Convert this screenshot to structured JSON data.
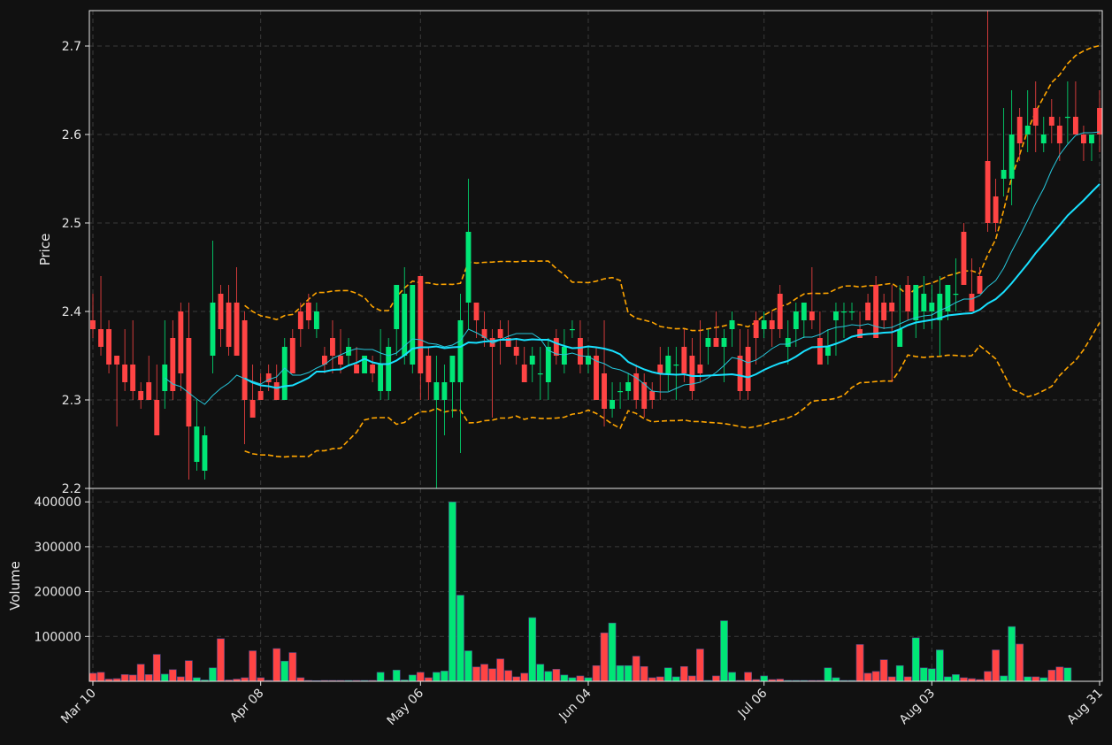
{
  "chart_data": {
    "type": "candlestick",
    "title": "",
    "ylabel_price": "Price",
    "ylabel_volume": "Volume",
    "price_ylim": [
      2.2,
      2.74
    ],
    "price_yticks": [
      "2.2",
      "2.3",
      "2.4",
      "2.5",
      "2.6",
      "2.7"
    ],
    "volume_ylim": [
      0,
      430000
    ],
    "volume_yticks": [
      "100000",
      "200000",
      "300000",
      "400000"
    ],
    "x_tick_labels": [
      "Mar 10",
      "Apr 08",
      "May 06",
      "Jun 04",
      "Jul 06",
      "Aug 03",
      "Aug 31"
    ],
    "x_tick_index": [
      0,
      21,
      41,
      62,
      84,
      105,
      126
    ],
    "grid": true,
    "up_color": "#00e676",
    "down_color": "#ff4444",
    "ma_colors": [
      "#26c6da",
      "#18e0ff"
    ],
    "bollinger_color": "#ffa500",
    "background_color": "#111111",
    "moving_averages": [
      "MA short",
      "MA long"
    ],
    "bollinger_bands": "dashed upper/lower bands",
    "ohlc": [
      [
        2.39,
        2.42,
        2.37,
        2.38
      ],
      [
        2.38,
        2.44,
        2.35,
        2.36
      ],
      [
        2.38,
        2.39,
        2.33,
        2.34
      ],
      [
        2.35,
        2.35,
        2.27,
        2.34
      ],
      [
        2.34,
        2.38,
        2.31,
        2.32
      ],
      [
        2.34,
        2.39,
        2.3,
        2.31
      ],
      [
        2.31,
        2.32,
        2.29,
        2.3
      ],
      [
        2.32,
        2.35,
        2.3,
        2.3
      ],
      [
        2.3,
        2.34,
        2.26,
        2.26
      ],
      [
        2.31,
        2.39,
        2.29,
        2.34
      ],
      [
        2.37,
        2.39,
        2.3,
        2.31
      ],
      [
        2.4,
        2.41,
        2.31,
        2.33
      ],
      [
        2.37,
        2.41,
        2.21,
        2.27
      ],
      [
        2.23,
        2.3,
        2.22,
        2.27
      ],
      [
        2.22,
        2.27,
        2.21,
        2.26
      ],
      [
        2.35,
        2.48,
        2.33,
        2.41
      ],
      [
        2.42,
        2.43,
        2.36,
        2.38
      ],
      [
        2.41,
        2.43,
        2.35,
        2.36
      ],
      [
        2.41,
        2.45,
        2.35,
        2.35
      ],
      [
        2.39,
        2.4,
        2.25,
        2.3
      ],
      [
        2.3,
        2.34,
        2.28,
        2.28
      ],
      [
        2.31,
        2.33,
        2.3,
        2.3
      ],
      [
        2.33,
        2.34,
        2.31,
        2.32
      ],
      [
        2.32,
        2.34,
        2.3,
        2.3
      ],
      [
        2.3,
        2.37,
        2.3,
        2.36
      ],
      [
        2.37,
        2.38,
        2.33,
        2.33
      ],
      [
        2.4,
        2.41,
        2.36,
        2.38
      ],
      [
        2.41,
        2.42,
        2.38,
        2.39
      ],
      [
        2.38,
        2.41,
        2.37,
        2.4
      ],
      [
        2.35,
        2.36,
        2.33,
        2.34
      ],
      [
        2.37,
        2.39,
        2.33,
        2.35
      ],
      [
        2.35,
        2.38,
        2.33,
        2.34
      ],
      [
        2.35,
        2.37,
        2.34,
        2.36
      ],
      [
        2.34,
        2.36,
        2.33,
        2.33
      ],
      [
        2.33,
        2.35,
        2.33,
        2.35
      ],
      [
        2.34,
        2.35,
        2.32,
        2.33
      ],
      [
        2.31,
        2.38,
        2.3,
        2.34
      ],
      [
        2.31,
        2.37,
        2.3,
        2.36
      ],
      [
        2.38,
        2.43,
        2.35,
        2.43
      ],
      [
        2.35,
        2.45,
        2.34,
        2.42
      ],
      [
        2.34,
        2.43,
        2.33,
        2.43
      ],
      [
        2.44,
        2.44,
        2.3,
        2.33
      ],
      [
        2.35,
        2.36,
        2.3,
        2.32
      ],
      [
        2.3,
        2.35,
        2.2,
        2.32
      ],
      [
        2.3,
        2.34,
        2.26,
        2.32
      ],
      [
        2.32,
        2.35,
        2.28,
        2.35
      ],
      [
        2.32,
        2.42,
        2.24,
        2.39
      ],
      [
        2.41,
        2.55,
        2.38,
        2.49
      ],
      [
        2.41,
        2.41,
        2.37,
        2.39
      ],
      [
        2.38,
        2.4,
        2.36,
        2.37
      ],
      [
        2.37,
        2.38,
        2.28,
        2.36
      ],
      [
        2.38,
        2.39,
        2.34,
        2.37
      ],
      [
        2.37,
        2.39,
        2.36,
        2.36
      ],
      [
        2.36,
        2.37,
        2.34,
        2.35
      ],
      [
        2.34,
        2.36,
        2.32,
        2.32
      ],
      [
        2.34,
        2.36,
        2.32,
        2.35
      ],
      [
        2.33,
        2.36,
        2.3,
        2.33
      ],
      [
        2.32,
        2.37,
        2.3,
        2.36
      ],
      [
        2.37,
        2.38,
        2.34,
        2.35
      ],
      [
        2.34,
        2.38,
        2.33,
        2.36
      ],
      [
        2.38,
        2.39,
        2.37,
        2.38
      ],
      [
        2.37,
        2.39,
        2.33,
        2.34
      ],
      [
        2.34,
        2.36,
        2.33,
        2.35
      ],
      [
        2.35,
        2.36,
        2.3,
        2.3
      ],
      [
        2.33,
        2.39,
        2.27,
        2.29
      ],
      [
        2.29,
        2.32,
        2.28,
        2.3
      ],
      [
        2.31,
        2.32,
        2.29,
        2.31
      ],
      [
        2.31,
        2.33,
        2.3,
        2.32
      ],
      [
        2.33,
        2.34,
        2.29,
        2.3
      ],
      [
        2.32,
        2.33,
        2.28,
        2.29
      ],
      [
        2.31,
        2.32,
        2.29,
        2.3
      ],
      [
        2.34,
        2.36,
        2.3,
        2.33
      ],
      [
        2.33,
        2.36,
        2.31,
        2.35
      ],
      [
        2.34,
        2.36,
        2.3,
        2.34
      ],
      [
        2.36,
        2.38,
        2.32,
        2.33
      ],
      [
        2.35,
        2.37,
        2.3,
        2.31
      ],
      [
        2.34,
        2.39,
        2.32,
        2.33
      ],
      [
        2.36,
        2.38,
        2.34,
        2.37
      ],
      [
        2.37,
        2.4,
        2.36,
        2.36
      ],
      [
        2.36,
        2.38,
        2.32,
        2.37
      ],
      [
        2.38,
        2.4,
        2.36,
        2.39
      ],
      [
        2.35,
        2.38,
        2.3,
        2.31
      ],
      [
        2.36,
        2.38,
        2.3,
        2.31
      ],
      [
        2.39,
        2.4,
        2.34,
        2.37
      ],
      [
        2.38,
        2.4,
        2.37,
        2.39
      ],
      [
        2.39,
        2.4,
        2.36,
        2.38
      ],
      [
        2.42,
        2.43,
        2.37,
        2.38
      ],
      [
        2.36,
        2.39,
        2.34,
        2.37
      ],
      [
        2.38,
        2.41,
        2.36,
        2.4
      ],
      [
        2.39,
        2.41,
        2.37,
        2.41
      ],
      [
        2.4,
        2.45,
        2.38,
        2.39
      ],
      [
        2.37,
        2.4,
        2.34,
        2.34
      ],
      [
        2.35,
        2.38,
        2.34,
        2.36
      ],
      [
        2.39,
        2.41,
        2.35,
        2.4
      ],
      [
        2.4,
        2.41,
        2.37,
        2.4
      ],
      [
        2.4,
        2.41,
        2.39,
        2.4
      ],
      [
        2.38,
        2.4,
        2.37,
        2.37
      ],
      [
        2.41,
        2.42,
        2.39,
        2.39
      ],
      [
        2.43,
        2.44,
        2.37,
        2.37
      ],
      [
        2.41,
        2.42,
        2.38,
        2.39
      ],
      [
        2.41,
        2.43,
        2.32,
        2.4
      ],
      [
        2.36,
        2.43,
        2.36,
        2.38
      ],
      [
        2.43,
        2.44,
        2.39,
        2.4
      ],
      [
        2.39,
        2.43,
        2.37,
        2.43
      ],
      [
        2.4,
        2.44,
        2.38,
        2.42
      ],
      [
        2.4,
        2.43,
        2.38,
        2.41
      ],
      [
        2.39,
        2.44,
        2.35,
        2.42
      ],
      [
        2.4,
        2.43,
        2.39,
        2.43
      ],
      [
        2.42,
        2.46,
        2.4,
        2.42
      ],
      [
        2.49,
        2.5,
        2.43,
        2.43
      ],
      [
        2.42,
        2.46,
        2.4,
        2.4
      ],
      [
        2.44,
        2.45,
        2.42,
        2.42
      ],
      [
        2.57,
        2.74,
        2.49,
        2.5
      ],
      [
        2.53,
        2.55,
        2.49,
        2.5
      ],
      [
        2.55,
        2.63,
        2.53,
        2.56
      ],
      [
        2.55,
        2.65,
        2.52,
        2.6
      ],
      [
        2.62,
        2.63,
        2.57,
        2.59
      ],
      [
        2.6,
        2.65,
        2.58,
        2.61
      ],
      [
        2.63,
        2.66,
        2.58,
        2.61
      ],
      [
        2.59,
        2.62,
        2.58,
        2.6
      ],
      [
        2.62,
        2.64,
        2.59,
        2.61
      ],
      [
        2.61,
        2.62,
        2.57,
        2.59
      ],
      [
        2.62,
        2.66,
        2.59,
        2.62
      ],
      [
        2.62,
        2.66,
        2.6,
        2.6
      ],
      [
        2.6,
        2.61,
        2.57,
        2.59
      ],
      [
        2.59,
        2.6,
        2.57,
        2.6
      ],
      [
        2.63,
        2.65,
        2.58,
        2.6
      ]
    ],
    "volume": [
      18000,
      20000,
      5000,
      6000,
      15000,
      14000,
      38000,
      15000,
      60000,
      16000,
      26000,
      10000,
      46000,
      8000,
      3000,
      30000,
      95000,
      3000,
      5000,
      8000,
      68000,
      8000,
      2000,
      73000,
      45000,
      64000,
      8000,
      2000,
      1500,
      2000,
      2000,
      2000,
      2000,
      2000,
      2000,
      2000,
      20000,
      2000,
      25000,
      3000,
      14000,
      20000,
      8000,
      20000,
      23000,
      400000,
      192000,
      68000,
      32000,
      38000,
      28000,
      50000,
      24000,
      10000,
      18000,
      142000,
      38000,
      22000,
      27000,
      14000,
      8000,
      12000,
      8000,
      35000,
      108000,
      130000,
      35000,
      35000,
      56000,
      33000,
      8000,
      10000,
      30000,
      10000,
      33000,
      12000,
      72000,
      2000,
      12000,
      135000,
      20000,
      2000,
      20000,
      4000,
      12000,
      4000,
      5000,
      2000,
      2000,
      2000,
      2000,
      2000,
      30000,
      8000,
      2000,
      2000,
      82000,
      18000,
      22000,
      48000,
      10000,
      35000,
      10000,
      97000,
      30000,
      28000,
      70000,
      10000,
      15000,
      8000,
      6000,
      4000,
      22000,
      70000,
      12000,
      122000,
      83000,
      10000,
      10000,
      8000,
      25000,
      32000,
      30000
    ]
  }
}
